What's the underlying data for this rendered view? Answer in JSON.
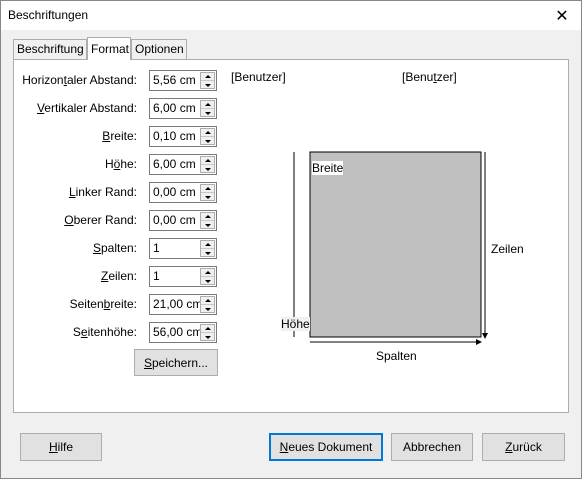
{
  "window": {
    "title": "Beschriftungen"
  },
  "tabs": [
    {
      "label": "Beschriftung"
    },
    {
      "label": "Format"
    },
    {
      "label": "Optionen"
    }
  ],
  "fields": [
    {
      "pre": "Horizon",
      "key": "t",
      "post": "aler Abstand:",
      "value": "5,56 cm"
    },
    {
      "pre": "",
      "key": "V",
      "post": "ertikaler Abstand:",
      "value": "6,00 cm"
    },
    {
      "pre": "",
      "key": "B",
      "post": "reite:",
      "value": "0,10 cm"
    },
    {
      "pre": "H",
      "key": "ö",
      "post": "he:",
      "value": "6,00 cm"
    },
    {
      "pre": "",
      "key": "L",
      "post": "inker Rand:",
      "value": "0,00 cm"
    },
    {
      "pre": "",
      "key": "O",
      "post": "berer Rand:",
      "value": "0,00 cm"
    },
    {
      "pre": "",
      "key": "S",
      "post": "palten:",
      "value": "1"
    },
    {
      "pre": "",
      "key": "Z",
      "post": "eilen:",
      "value": "1"
    },
    {
      "pre": "Seiten",
      "key": "b",
      "post": "reite:",
      "value": "21,00 cm"
    },
    {
      "pre": "S",
      "key": "e",
      "post": "itenhöhe:",
      "value": "56,00 cm"
    }
  ],
  "save_button": {
    "key": "S",
    "rest": "peichern..."
  },
  "user_labels": {
    "left": "[Benutzer]",
    "right_pre": "[Benu",
    "right_key": "t",
    "right_post": "zer]"
  },
  "preview": {
    "breite": "Breite",
    "hoehe": "Höhe",
    "zeilen": "Zeilen",
    "spalten": "Spalten",
    "fill_color": "#c0c0c0"
  },
  "footer": {
    "help": {
      "key": "H",
      "rest": "ilfe"
    },
    "new_doc": {
      "key": "N",
      "rest": "eues Dokument"
    },
    "cancel": "Abbrechen",
    "back": {
      "key": "Z",
      "rest": "urück"
    }
  },
  "colors": {
    "accent": "#0078d7",
    "dialog_bg": "#f0f0f0"
  }
}
